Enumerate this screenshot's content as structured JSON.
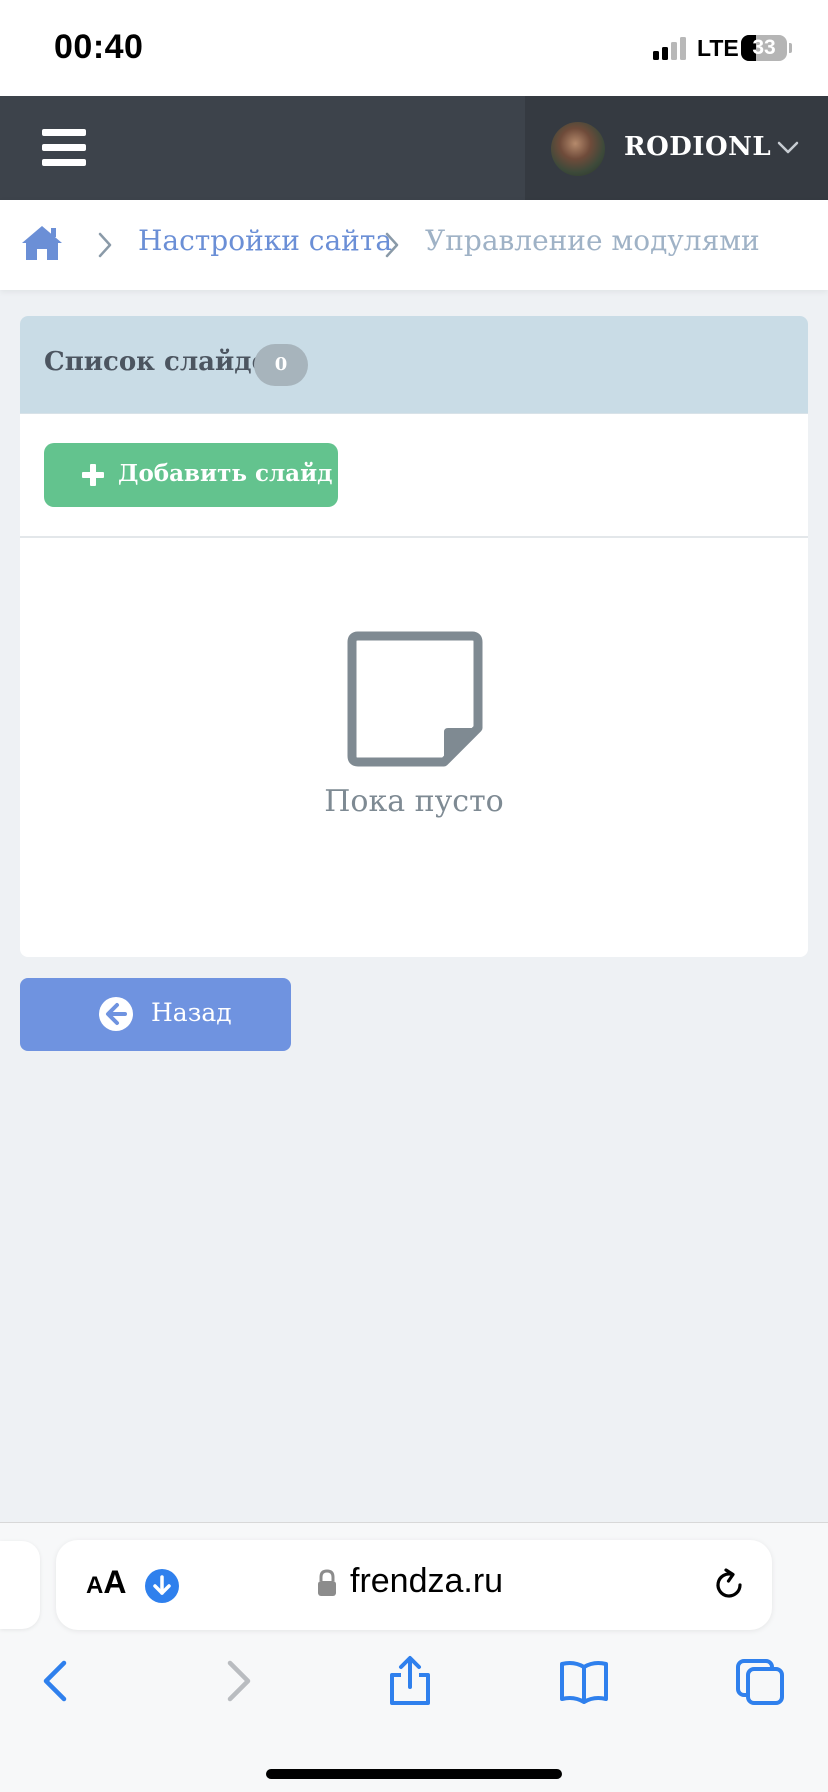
{
  "status_bar": {
    "time": "00:40",
    "network": "LTE",
    "battery_level": "33"
  },
  "topnav": {
    "menu_icon": "hamburger-icon",
    "username": "RODIONL",
    "dropdown_icon": "chevron-down-icon"
  },
  "breadcrumb": {
    "home_icon": "home-icon",
    "items": [
      {
        "label": "Настройки сайта",
        "link": true
      },
      {
        "label": "Управление модулями",
        "link": false
      }
    ]
  },
  "panel": {
    "title": "Список слайдов",
    "count": "0",
    "add_button_label": "Добавить слайд",
    "empty_text": "Пока пусто"
  },
  "back_button": {
    "label": "Назад",
    "icon": "arrow-circle-left-icon"
  },
  "browser": {
    "text_size_label_small": "A",
    "text_size_label_big": "A",
    "domain": "frendza.ru",
    "icons": [
      "back-icon",
      "forward-icon",
      "share-icon",
      "bookmarks-icon",
      "tabs-icon"
    ]
  },
  "colors": {
    "topnav": "#3d434b",
    "panel_header": "#c9dce6",
    "add_button": "#63c38e",
    "back_button": "#6f93e0",
    "link": "#6b8fd6",
    "ios_blue": "#2f80ed"
  }
}
